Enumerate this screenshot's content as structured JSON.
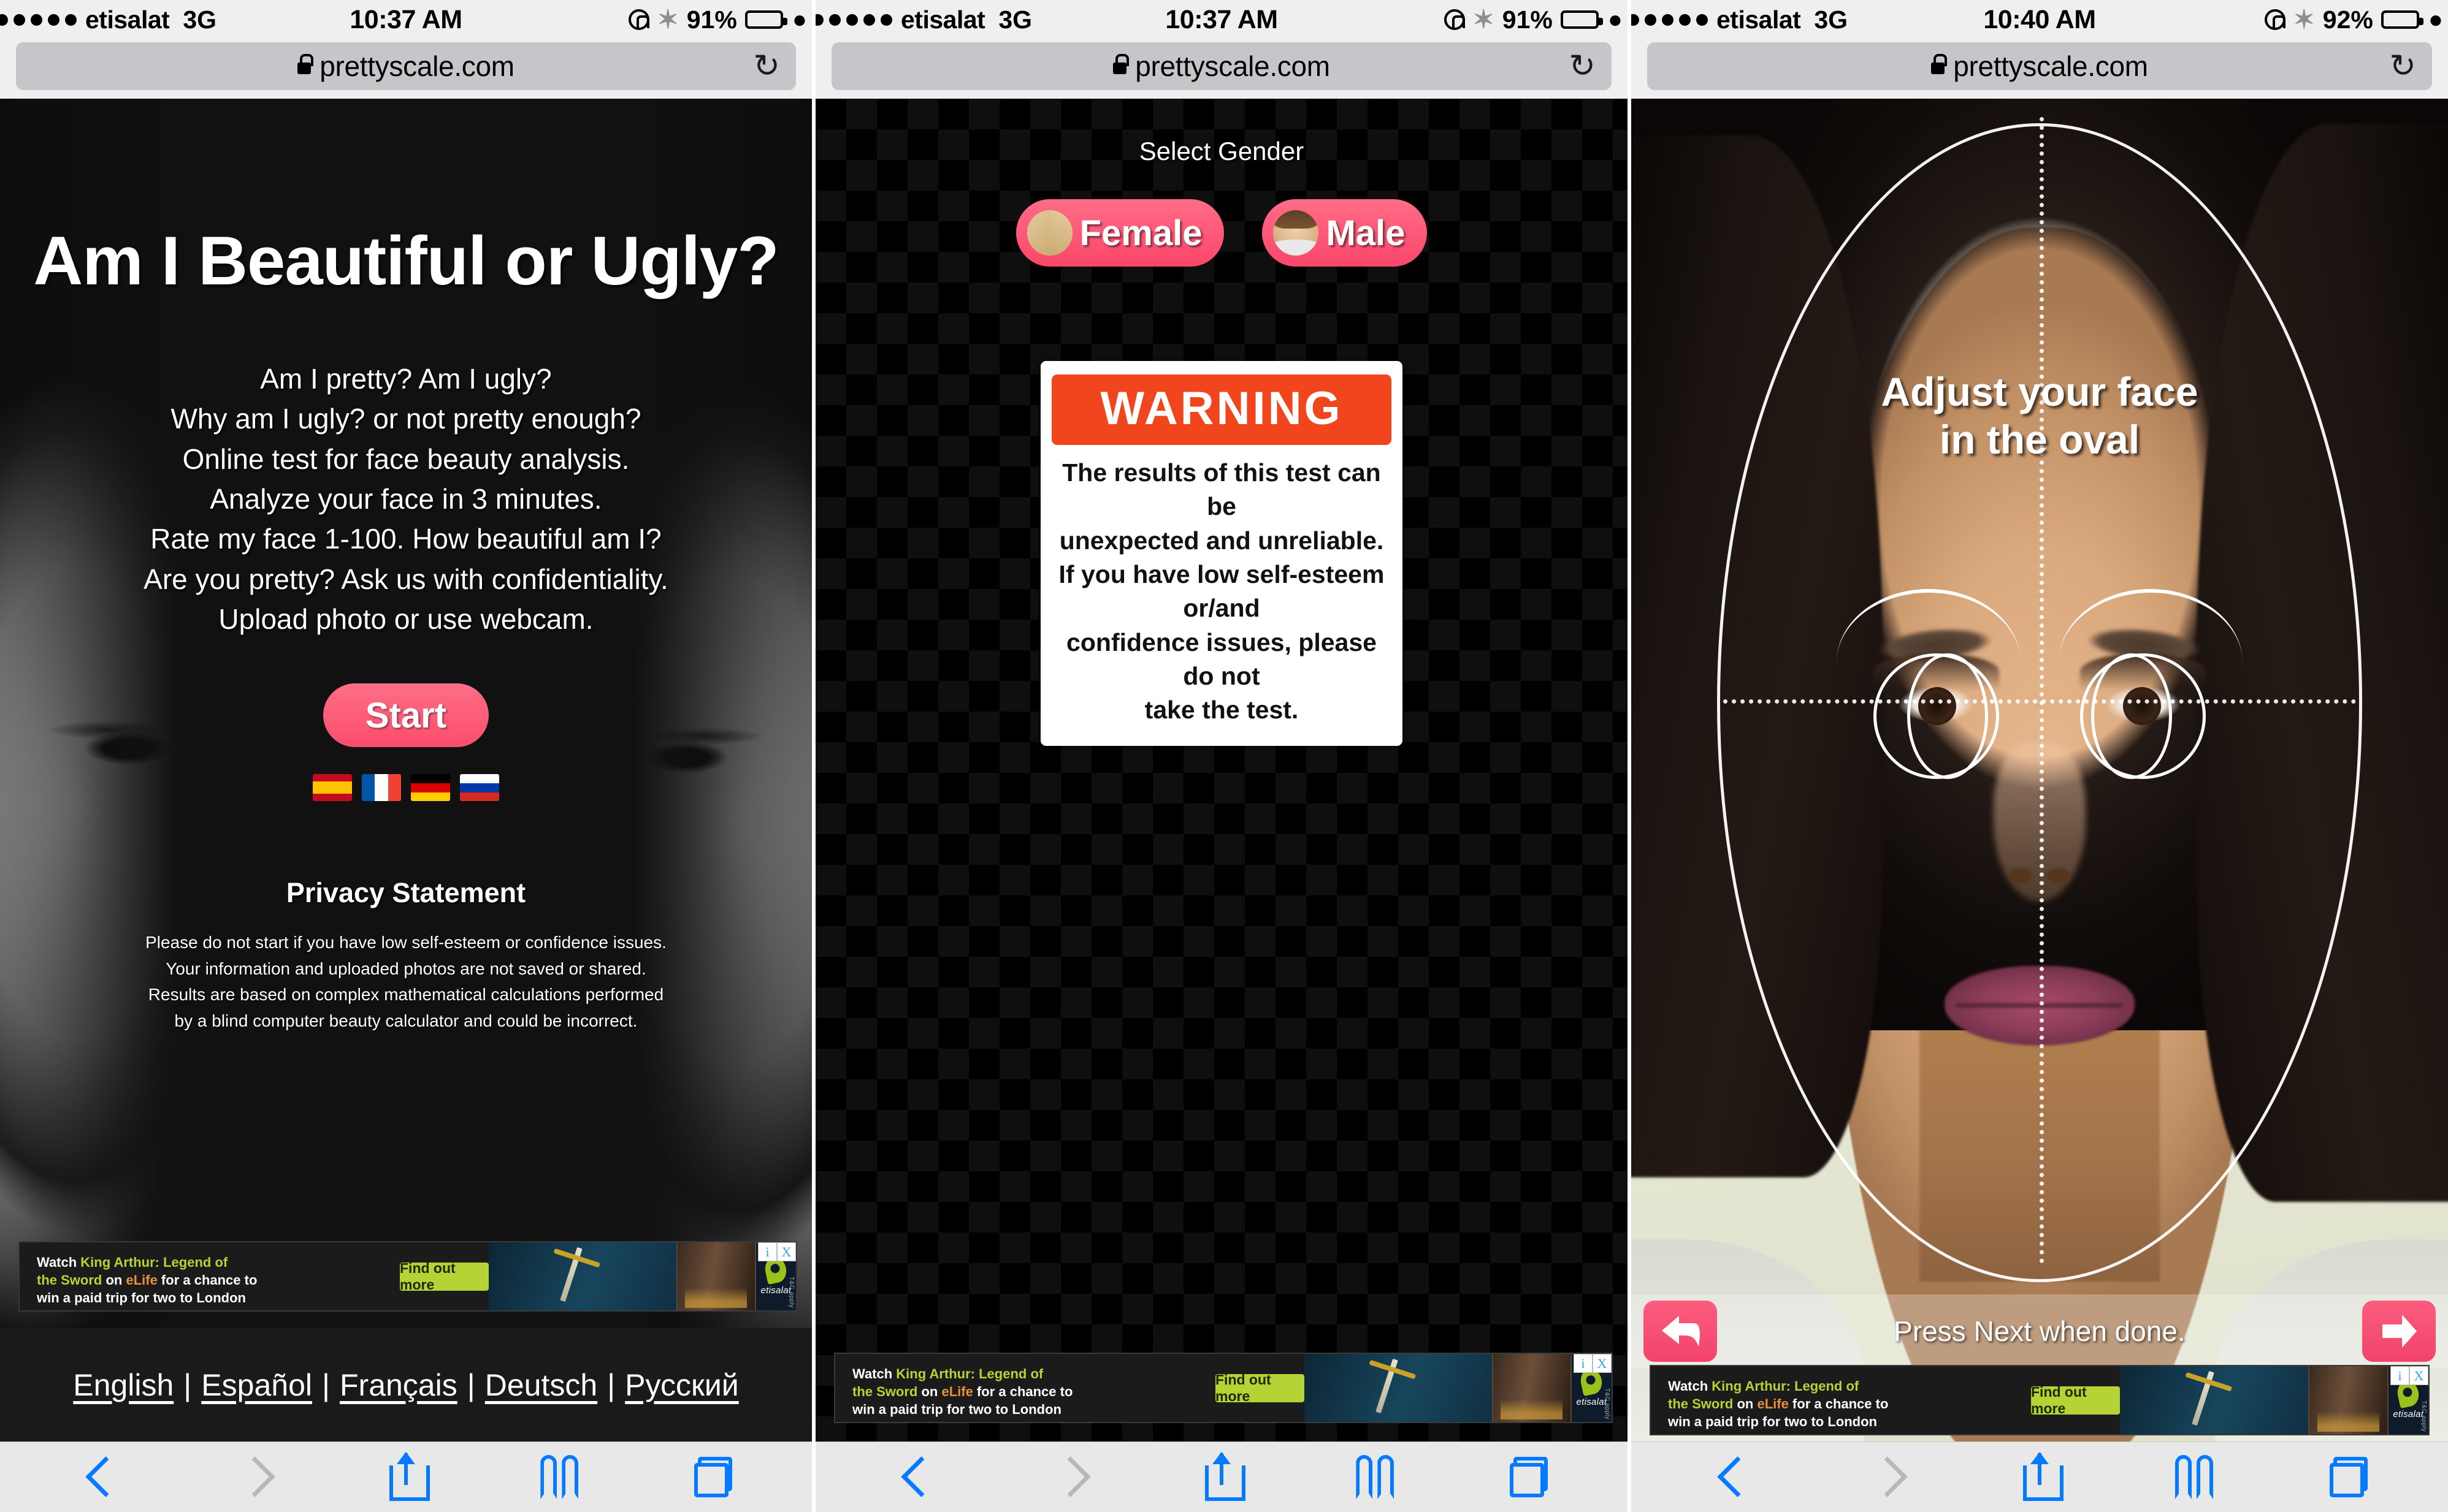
{
  "browser": {
    "url": "prettyscale.com",
    "lock_icon": "lock-icon",
    "reload_icon": "reload-icon",
    "toolbar": {
      "back_label": "back-chevron-icon",
      "forward_label": "forward-chevron-icon",
      "share_label": "share-icon",
      "bookmarks_label": "bookmarks-icon",
      "tabs_label": "tabs-icon"
    }
  },
  "panels": [
    {
      "statusbar": {
        "carrier": "etisalat",
        "network": "3G",
        "time": "10:37 AM",
        "battery_percent": "91%",
        "rotation_lock_icon": "rotation-lock-icon",
        "bluetooth_icon": "bluetooth-icon",
        "battery_icon": "battery-icon"
      },
      "page": {
        "title": "Am I Beautiful or Ugly?",
        "description_lines": [
          "Am I pretty? Am I ugly?",
          "Why am I ugly? or not pretty enough?",
          "Online test for face beauty analysis.",
          "Analyze your face in 3 minutes.",
          "Rate my face 1-100. How beautiful am I?",
          "Are you pretty? Ask us with confidentiality.",
          "Upload photo or use webcam."
        ],
        "start_button": "Start",
        "flags": [
          "spain-flag",
          "france-flag",
          "germany-flag",
          "russia-flag"
        ],
        "privacy_title": "Privacy Statement",
        "privacy_lines": [
          "Please do not start if you have low self-esteem or confidence issues.",
          "Your information and uploaded photos are not saved or shared.",
          "Results are based on complex mathematical calculations performed",
          "by a blind computer beauty calculator and could be incorrect."
        ],
        "languages": [
          "English",
          "Español",
          "Français",
          "Deutsch",
          "Русский"
        ],
        "lang_separator": "|"
      }
    },
    {
      "statusbar": {
        "carrier": "etisalat",
        "network": "3G",
        "time": "10:37 AM",
        "battery_percent": "91%",
        "rotation_lock_icon": "rotation-lock-icon",
        "bluetooth_icon": "bluetooth-icon",
        "battery_icon": "battery-icon"
      },
      "page": {
        "select_gender_label": "Select Gender",
        "female_button": "Female",
        "male_button": "Male",
        "warning_heading": "WARNING",
        "warning_lines": [
          "The results of this test can be",
          "unexpected and unreliable.",
          "If you have low self-esteem or/and",
          "confidence issues, please do not",
          "take the test."
        ]
      }
    },
    {
      "statusbar": {
        "carrier": "etisalat",
        "network": "3G",
        "time": "10:40 AM",
        "battery_percent": "92%",
        "rotation_lock_icon": "rotation-lock-icon",
        "bluetooth_icon": "bluetooth-icon",
        "battery_icon": "battery-icon"
      },
      "page": {
        "adjust_line1": "Adjust your face",
        "adjust_line2": "in the oval",
        "next_hint": "Press Next when done.",
        "back_button": "back-arrow-icon",
        "next_button": "next-arrow-icon"
      }
    }
  ],
  "ad": {
    "line1_plain": "Watch ",
    "line1_green": "King Arthur: Legend of",
    "line2_green": "the Sword",
    "line2_mid": " on ",
    "line2_orange": "eLife",
    "line2_rest": " for a chance to",
    "line3": "win a paid trip for two to London",
    "cta": "Find out more",
    "brand": "etisalat",
    "terms": "T&C apply",
    "info_icon": "i",
    "close_icon": "X"
  },
  "colors": {
    "accent_pink": "#fb4669",
    "warning_red": "#f1461d",
    "safari_blue": "#067aff",
    "battery_green": "#4cd964",
    "ad_green": "#b5d334"
  }
}
